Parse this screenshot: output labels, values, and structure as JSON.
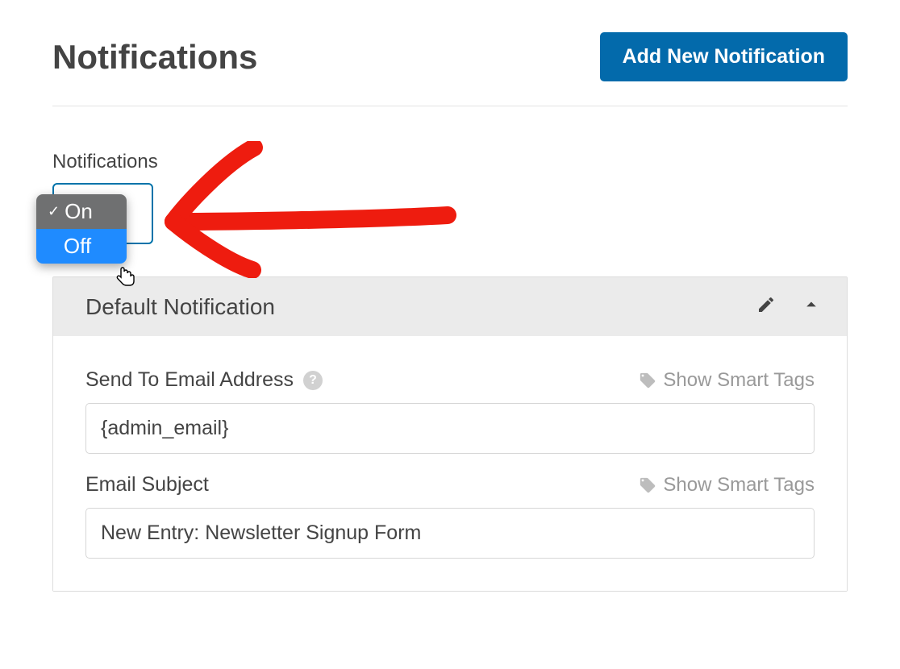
{
  "header": {
    "title": "Notifications",
    "add_button": "Add New Notification"
  },
  "toggle": {
    "section_label": "Notifications",
    "on_label": "On",
    "off_label": "Off",
    "selected": "On"
  },
  "panel": {
    "title": "Default Notification",
    "fields": {
      "send_to": {
        "label": "Send To Email Address",
        "value": "{admin_email}",
        "smart_tags": "Show Smart Tags"
      },
      "subject": {
        "label": "Email Subject",
        "value": "New Entry: Newsletter Signup Form",
        "smart_tags": "Show Smart Tags"
      }
    }
  }
}
